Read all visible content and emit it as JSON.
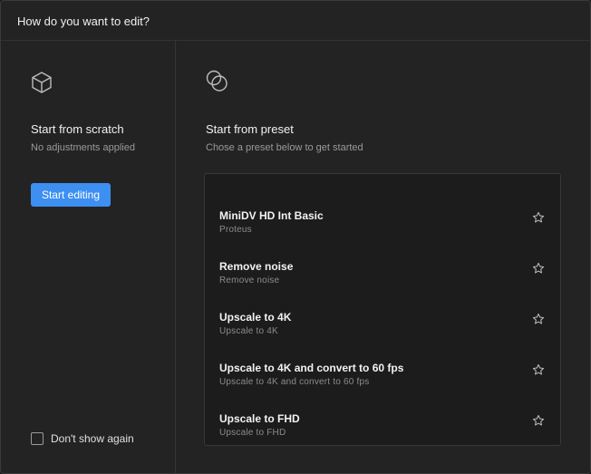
{
  "dialog": {
    "title": "How do you want to edit?"
  },
  "scratch": {
    "icon": "cube-icon",
    "heading": "Start from scratch",
    "subtitle": "No adjustments applied",
    "button_label": "Start editing",
    "accent": "#3d8ff2"
  },
  "dont_show": {
    "label": "Don't show again",
    "checked": false
  },
  "preset": {
    "icon": "overlapping-circles-icon",
    "heading": "Start from preset",
    "subtitle": "Chose a preset below to get started",
    "items": [
      {
        "name": "MiniDV HD Int Basic",
        "desc": "Proteus"
      },
      {
        "name": "Remove noise",
        "desc": "Remove noise"
      },
      {
        "name": "Upscale to 4K",
        "desc": "Upscale to 4K"
      },
      {
        "name": "Upscale to 4K and convert to 60 fps",
        "desc": "Upscale to 4K and convert to 60 fps"
      },
      {
        "name": "Upscale to FHD",
        "desc": "Upscale to FHD"
      }
    ]
  }
}
